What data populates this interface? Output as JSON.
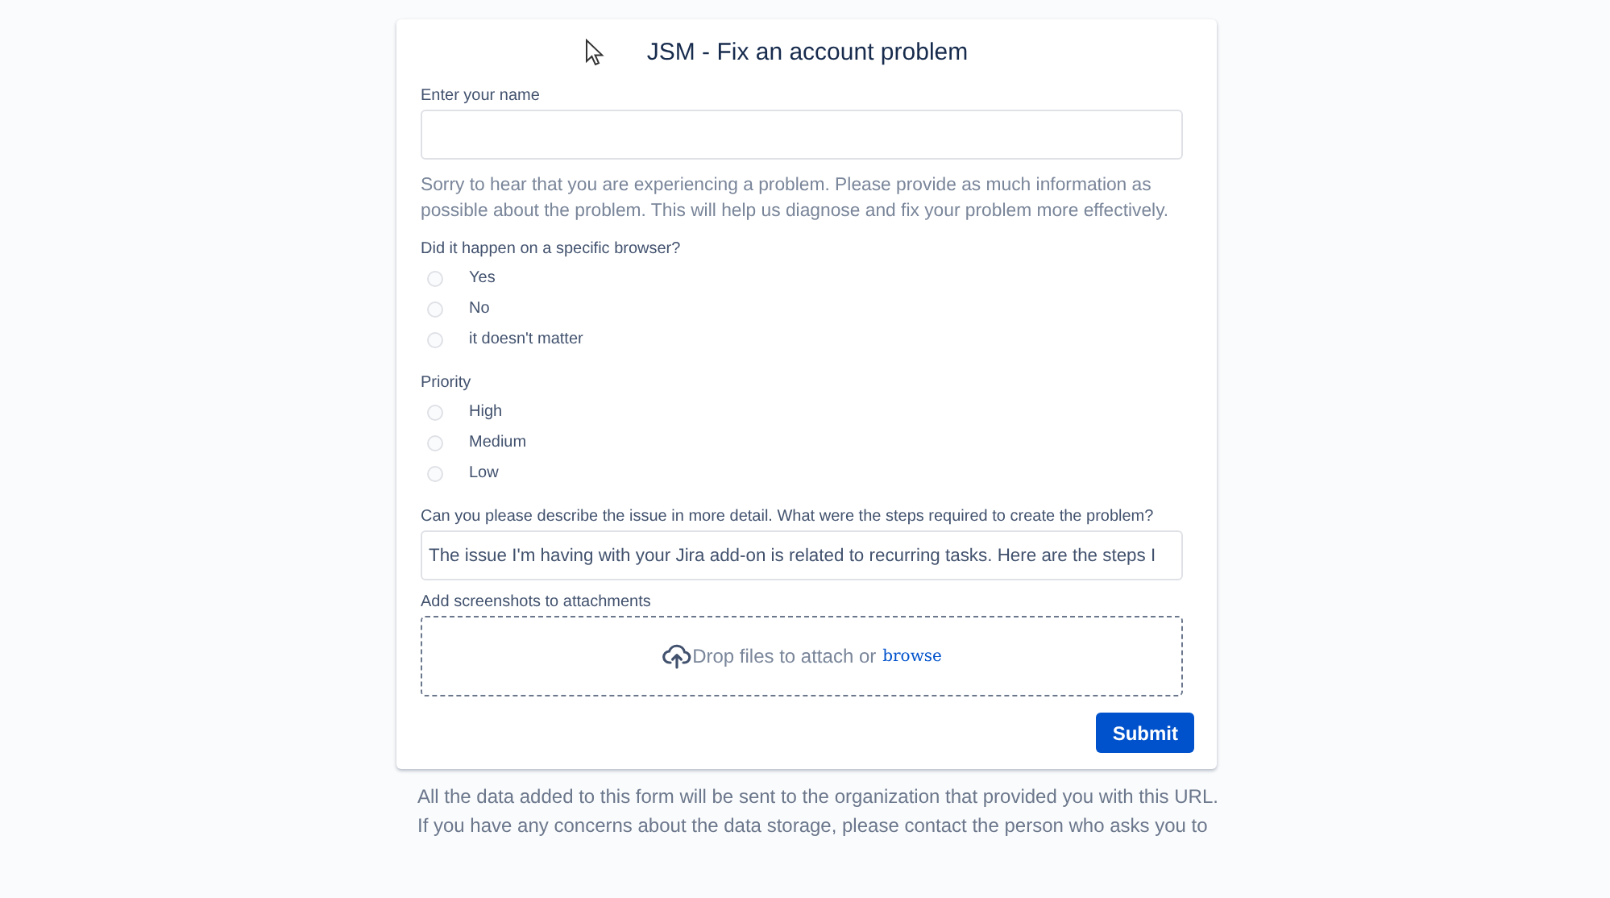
{
  "form": {
    "title": "JSM - Fix an account problem",
    "fields": [
      {
        "kind": "text",
        "label": "Enter your name"
      },
      {
        "kind": "paragraph",
        "text": "Sorry to hear that you are experiencing a problem. Please provide as much information as possible about the problem. This will help us diagnose and fix your problem more effectively."
      },
      {
        "kind": "radio",
        "label": "Did it happen on a specific browser?",
        "options": [
          {
            "label": "Yes",
            "selected": false
          },
          {
            "label": "No",
            "selected": false
          },
          {
            "label": "it doesn't matter",
            "selected": false
          }
        ]
      },
      {
        "kind": "radio",
        "label": "Priority",
        "options": [
          {
            "label": "High",
            "selected": false
          },
          {
            "label": "Medium",
            "selected": false
          },
          {
            "label": "Low",
            "selected": false
          }
        ]
      },
      {
        "kind": "text",
        "label": "Can you please describe the issue in more detail. What were the steps required to create the problem?",
        "value": "The issue I'm having with your Jira add-on is related to recurring tasks. Here are the steps I"
      },
      {
        "kind": "upload",
        "label": "Add screenshots to attachments",
        "text": "Drop files to attach or",
        "link": "browse"
      }
    ],
    "submit": "Submit"
  },
  "footer": [
    "All the data added to this form will be sent to the organization that provided you with this URL.",
    "If you have any concerns about the data storage, please contact the person who asks you to"
  ]
}
